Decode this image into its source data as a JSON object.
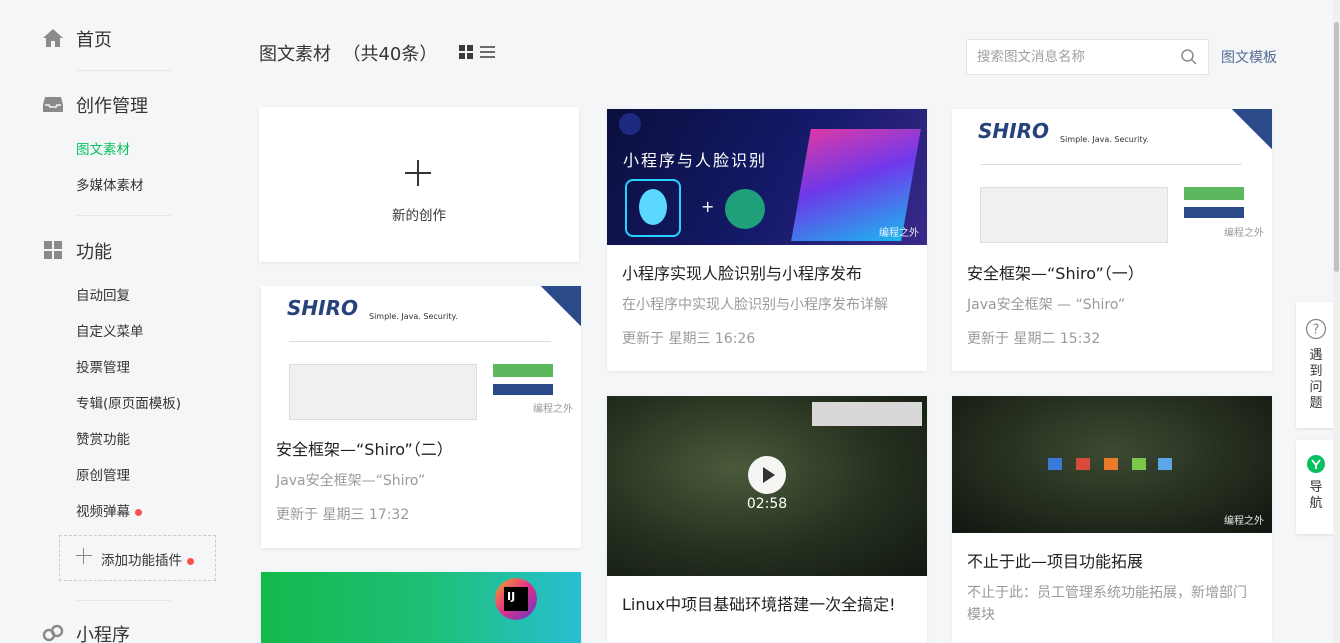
{
  "sidebar": {
    "home": "首页",
    "creation": {
      "title": "创作管理",
      "items": [
        "图文素材",
        "多媒体素材"
      ]
    },
    "functions": {
      "title": "功能",
      "items": [
        "自动回复",
        "自定义菜单",
        "投票管理",
        "专辑(原页面模板)",
        "赞赏功能",
        "原创管理",
        "视频弹幕"
      ]
    },
    "add_plugin": "添加功能插件",
    "miniprogram": "小程序"
  },
  "header": {
    "title": "图文素材  （共40条）",
    "search_placeholder": "搜索图文消息名称",
    "template_link": "图文模板"
  },
  "new_card": {
    "label": "新的创作"
  },
  "cards": [
    {
      "title": "安全框架—“Shiro”（二）",
      "desc": "Java安全框架—“Shiro”",
      "time": "更新于 星期三 17:32",
      "cover_texts": {
        "logo": "SHIRO",
        "slogan": "Simple. Java. Security."
      }
    },
    {
      "title": "小程序实现人脸识别与小程序发布",
      "desc": "在小程序中实现人脸识别与小程序发布详解",
      "time": "更新于 星期三 16:26",
      "cover_texts": {
        "headline": "小程序与人脸识别"
      }
    },
    {
      "title": "Linux中项目基础环境搭建一次全搞定!",
      "desc": "",
      "time": "",
      "cover_texts": {
        "duration": "02:58"
      }
    },
    {
      "title": "安全框架—“Shiro”（一）",
      "desc": "Java安全框架 — “Shiro”",
      "time": "更新于 星期二 15:32",
      "cover_texts": {
        "logo": "SHIRO",
        "slogan": "Simple. Java. Security."
      }
    },
    {
      "title": "不止于此—项目功能拓展",
      "desc": "不止于此：员工管理系统功能拓展，新增部门模块",
      "time": "",
      "cover_texts": {}
    },
    {
      "title": "",
      "desc": "",
      "time": "",
      "cover_texts": {
        "badge": "IJ"
      }
    }
  ],
  "watermark": "编程之外",
  "float": {
    "help": "遇到问题",
    "nav": "导航"
  },
  "colors": {
    "accent": "#07c160",
    "link": "#576b95",
    "badge": "#fa5151"
  }
}
